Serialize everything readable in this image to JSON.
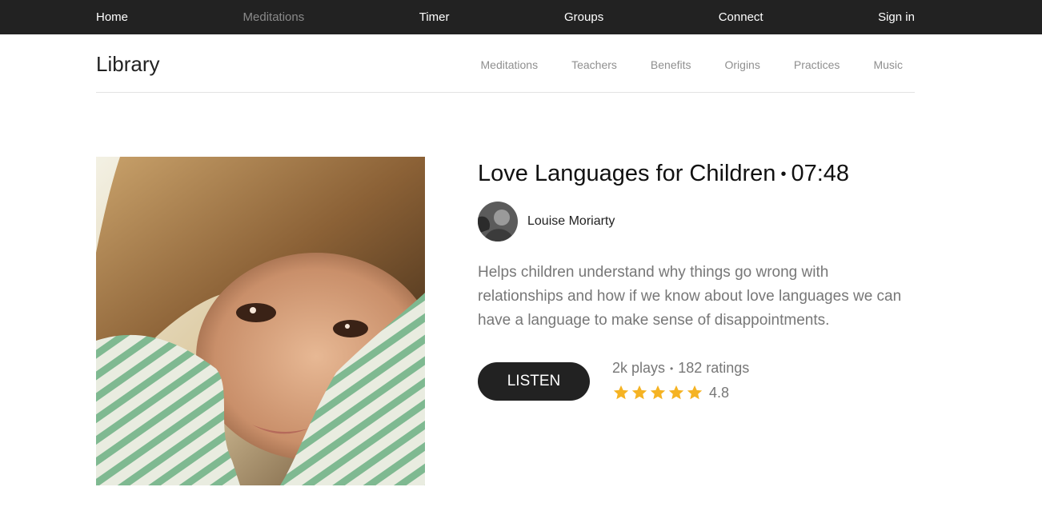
{
  "topnav": {
    "items": [
      {
        "label": "Home",
        "active": false
      },
      {
        "label": "Meditations",
        "active": true
      },
      {
        "label": "Timer",
        "active": false
      },
      {
        "label": "Groups",
        "active": false
      },
      {
        "label": "Connect",
        "active": false
      },
      {
        "label": "Sign in",
        "active": false
      }
    ]
  },
  "subheader": {
    "title": "Library",
    "items": [
      "Meditations",
      "Teachers",
      "Benefits",
      "Origins",
      "Practices",
      "Music"
    ]
  },
  "track": {
    "title": "Love Languages for Children",
    "separator": "•",
    "duration": "07:48",
    "author": "Louise Moriarty",
    "description": "Helps children understand why things go wrong with relationships and how if we know about love languages we can have a language to make sense of disappointments.",
    "listen_label": "LISTEN",
    "plays": "2k plays",
    "stats_separator": "•",
    "ratings": "182 ratings",
    "stars": 5,
    "rating_value": "4.8"
  },
  "colors": {
    "topbar": "#222222",
    "star": "#f5b323",
    "muted_text": "#777777"
  },
  "icons": {
    "star": "star-icon",
    "avatar": "teacher-avatar-photo"
  }
}
